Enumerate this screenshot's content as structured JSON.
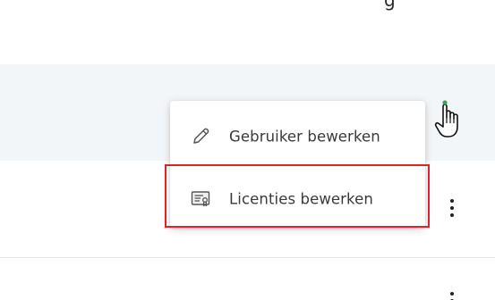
{
  "menu": {
    "items": [
      {
        "label": "Gebruiker bewerken",
        "icon": "pencil-icon"
      },
      {
        "label": "Licenties bewerken",
        "icon": "certificate-icon"
      }
    ]
  },
  "colors": {
    "row_highlight": "#f3f6f8",
    "annotation_red": "#e0222a",
    "cursor_dot": "#3aa655"
  }
}
